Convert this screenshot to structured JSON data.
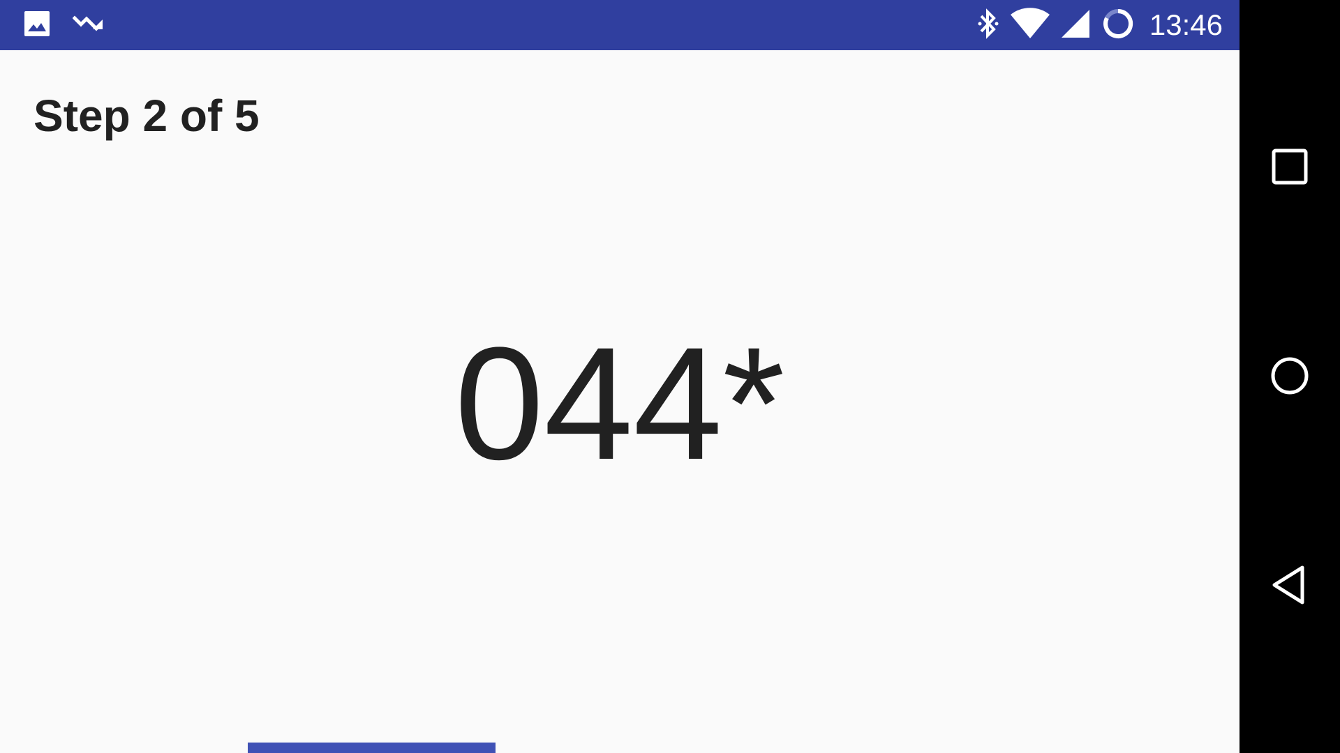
{
  "status_bar": {
    "background_color": "#303f9f",
    "left_icons": [
      "image-notification-icon",
      "trending-down-notification-icon"
    ],
    "right_icons": [
      "bluetooth-icon",
      "wifi-icon",
      "cellular-signal-icon",
      "battery-saver-icon"
    ],
    "time": "13:46"
  },
  "main": {
    "step_label": "Step 2 of 5",
    "entry_display": "044*"
  },
  "bottom_button": {
    "color": "#3f51b5"
  },
  "navigation_bar": {
    "background_color": "#000000",
    "buttons": [
      "recents-icon",
      "home-icon",
      "back-icon"
    ]
  }
}
